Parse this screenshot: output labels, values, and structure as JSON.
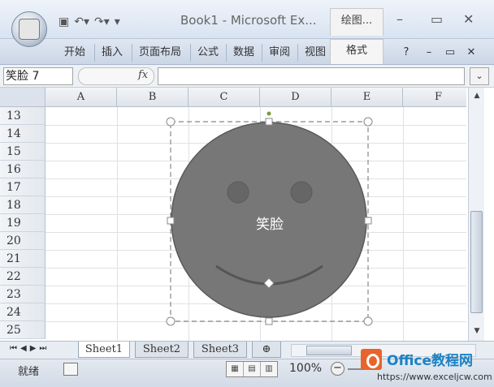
{
  "window": {
    "title": "Book1 - Microsoft Ex...",
    "office_button_logo": "Office",
    "contextual_tab": "绘图...",
    "controls": [
      "–",
      "▭",
      "✕"
    ]
  },
  "quick_access": {
    "save_icon": "save-icon",
    "undo_icon": "undo-icon",
    "redo_icon": "redo-icon"
  },
  "ribbon": {
    "tabs": [
      "开始",
      "插入",
      "页面布局",
      "公式",
      "数据",
      "审阅",
      "视图"
    ],
    "format_tab": "格式",
    "right_controls": [
      "?",
      "–",
      "▭",
      "✕"
    ]
  },
  "formula_bar": {
    "name_box": "笑脸  7",
    "fx": "fx",
    "value": ""
  },
  "grid": {
    "columns": [
      "A",
      "B",
      "C",
      "D",
      "E",
      "F"
    ],
    "rows": [
      "13",
      "14",
      "15",
      "16",
      "17",
      "18",
      "19",
      "20",
      "21",
      "22",
      "23",
      "24",
      "25"
    ]
  },
  "shape": {
    "name": "smiley-face",
    "text": "笑脸",
    "fill": "#777777",
    "eye_fill": "#666666",
    "mouth_color": "#555555"
  },
  "sheets": {
    "tabs": [
      "Sheet1",
      "Sheet2",
      "Sheet3"
    ],
    "active": "Sheet1"
  },
  "status": {
    "ready": "就绪",
    "zoom": "100%"
  },
  "watermark": {
    "title": "Office教程网",
    "url": "https://www.exceljcw.com"
  }
}
